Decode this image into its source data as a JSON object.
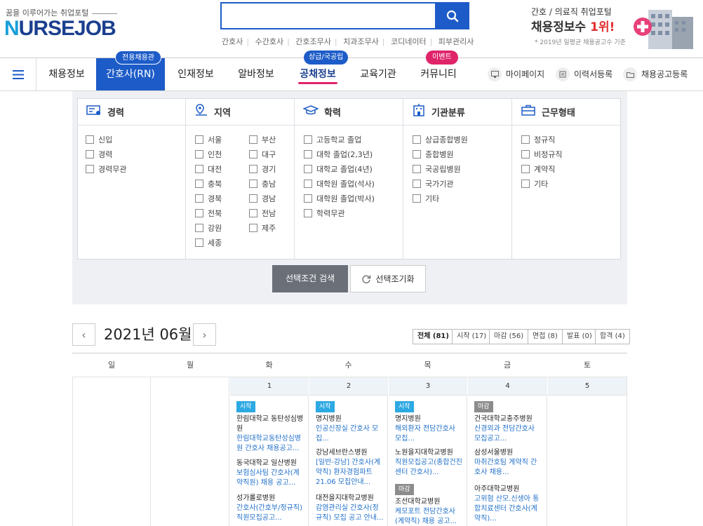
{
  "header": {
    "tagline": "꿈을 이루어가는 취업포털",
    "logo_part1": "N",
    "logo_part2": "URSEJOB",
    "search": {
      "value": "",
      "placeholder": ""
    },
    "quick_links": [
      "간호사",
      "수간호사",
      "간호조무사",
      "치과조무사",
      "코디네이터",
      "피부관리사"
    ],
    "promo": {
      "line1": "간호 / 의료직 취업포털",
      "line2a": "채용정보수 ",
      "line2b": "1위!",
      "line3": "* 2019년 일평균 채용공고수 기준"
    }
  },
  "nav": {
    "items": [
      "채용정보",
      "간호사(RN)",
      "인재정보",
      "알바정보",
      "공채정보",
      "교육기관",
      "커뮤니티"
    ],
    "badges": {
      "exclusive": "전용채용관",
      "public": "상급/국공립",
      "event": "이벤트"
    },
    "utility": [
      "마이페이지",
      "이력서등록",
      "채용공고등록"
    ]
  },
  "filters": {
    "career": {
      "title": "경력",
      "options": [
        "신입",
        "경력",
        "경력무관"
      ]
    },
    "region": {
      "title": "지역",
      "options": [
        "서울",
        "부산",
        "인천",
        "대구",
        "대전",
        "경기",
        "충북",
        "충남",
        "경북",
        "경남",
        "전북",
        "전남",
        "강원",
        "제주",
        "세종"
      ]
    },
    "education": {
      "title": "학력",
      "options": [
        "고등학교 졸업",
        "대학 졸업(2,3년)",
        "대학교 졸업(4년)",
        "대학원 졸업(석사)",
        "대학원 졸업(박사)",
        "학력무관"
      ]
    },
    "institution": {
      "title": "기관분류",
      "options": [
        "상급종합병원",
        "종합병원",
        "국공립병원",
        "국가기관",
        "기타"
      ]
    },
    "worktype": {
      "title": "근무형태",
      "options": [
        "정규직",
        "비정규직",
        "계약직",
        "기타"
      ]
    },
    "search_button": "선택조건 검색",
    "reset_button": "선택조기화"
  },
  "calendar": {
    "month_title": "2021년 06월",
    "tabs": [
      "전체 (81)",
      "시작 (17)",
      "마감 (56)",
      "면접 (8)",
      "발표 (0)",
      "합격 (4)"
    ],
    "weekdays": [
      "일",
      "월",
      "화",
      "수",
      "목",
      "금",
      "토"
    ],
    "dates": [
      "1",
      "2",
      "3",
      "4",
      "5"
    ],
    "tag_start": "시작",
    "tag_close": "마감",
    "tue": [
      {
        "hospital": "한림대학교 동탄성심병원",
        "job": "한림대학교동탄성심병원 간호사 채용공고..."
      },
      {
        "hospital": "동국대학교 일산병원",
        "job": "보험심사팀 간호사(계약직원) 채용 공고..."
      },
      {
        "hospital": "성가롤로병원",
        "job": "간호사(간호부/정규직) 직원모집공고..."
      }
    ],
    "wed": [
      {
        "hospital": "명지병원",
        "job": "인공신장실 간호사 모집..."
      },
      {
        "hospital": "강남세브란스병원",
        "job": "[일반-강남] 간호사(계약직) 환자경험파트 21.06 모집안내..."
      },
      {
        "hospital": "대전을지대학교병원",
        "job": "감염관리실 간호사(정규직) 모집 공고 안내..."
      }
    ],
    "thu": [
      {
        "hospital": "명지병원",
        "job": "해외환자 전담간호사 모집..."
      },
      {
        "hospital": "노원을지대학교병원",
        "job": "직원모집공고(종합건진센터 간호사)..."
      },
      {
        "hospital": "조선대학교병원",
        "job": "케모포트 전담간호사(계약직) 채용 공고..."
      }
    ],
    "fri": [
      {
        "hospital": "건국대학교충주병원",
        "job": "신경외과 전담간호사 모집공고..."
      },
      {
        "hospital": "삼성서울병원",
        "job": "마취간호팀 계약직 간호사 채용..."
      },
      {
        "hospital": "아주대학교병원",
        "job": "고위험 산모.신생아 통합치료센터 간호사(계약직)..."
      }
    ]
  },
  "colors": {
    "brand_blue": "#1d5cc8",
    "event_pink": "#e0246a",
    "start_tag": "#2da9e3",
    "close_tag": "#8c8c8c"
  }
}
